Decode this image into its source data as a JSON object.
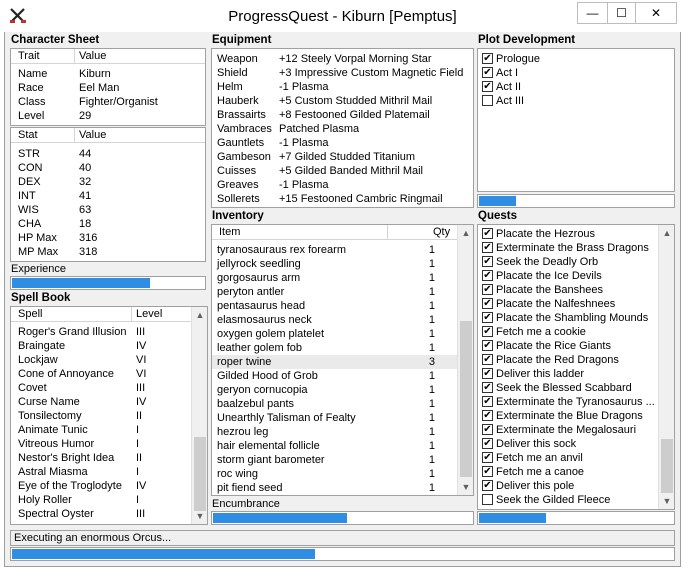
{
  "window": {
    "title": "ProgressQuest - Kiburn [Pemptus]",
    "icon": "swords-icon",
    "minimize": "—",
    "maximize": "☐",
    "close": "✕"
  },
  "character_sheet": {
    "label": "Character Sheet",
    "traits_header": [
      "Trait",
      "Value"
    ],
    "traits": [
      {
        "k": "Name",
        "v": "Kiburn"
      },
      {
        "k": "Race",
        "v": "Eel Man"
      },
      {
        "k": "Class",
        "v": "Fighter/Organist"
      },
      {
        "k": "Level",
        "v": "29"
      }
    ],
    "stats_header": [
      "Stat",
      "Value"
    ],
    "stats": [
      {
        "k": "STR",
        "v": "44"
      },
      {
        "k": "CON",
        "v": "40"
      },
      {
        "k": "DEX",
        "v": "32"
      },
      {
        "k": "INT",
        "v": "41"
      },
      {
        "k": "WIS",
        "v": "63"
      },
      {
        "k": "CHA",
        "v": "18"
      },
      {
        "k": "HP Max",
        "v": "316"
      },
      {
        "k": "MP Max",
        "v": "318"
      }
    ],
    "experience_label": "Experience",
    "experience_progress": 0.72
  },
  "spell_book": {
    "label": "Spell Book",
    "header": [
      "Spell",
      "Level"
    ],
    "spells": [
      {
        "name": "Roger's Grand Illusion",
        "level": "III"
      },
      {
        "name": "Braingate",
        "level": "IV"
      },
      {
        "name": "Lockjaw",
        "level": "VI"
      },
      {
        "name": "Cone of Annoyance",
        "level": "VI"
      },
      {
        "name": "Covet",
        "level": "III"
      },
      {
        "name": "Curse Name",
        "level": "IV"
      },
      {
        "name": "Tonsilectomy",
        "level": "II"
      },
      {
        "name": "Animate Tunic",
        "level": "I"
      },
      {
        "name": "Vitreous Humor",
        "level": "I"
      },
      {
        "name": "Nestor's Bright Idea",
        "level": "II"
      },
      {
        "name": "Astral Miasma",
        "level": "I"
      },
      {
        "name": "Eye of the Troglodyte",
        "level": "IV"
      },
      {
        "name": "Holy Roller",
        "level": "I"
      },
      {
        "name": "Spectral Oyster",
        "level": "III"
      }
    ]
  },
  "equipment": {
    "label": "Equipment",
    "items": [
      {
        "slot": "Weapon",
        "item": "+12 Steely Vorpal Morning Star"
      },
      {
        "slot": "Shield",
        "item": "+3 Impressive Custom Magnetic Field"
      },
      {
        "slot": "Helm",
        "item": "-1 Plasma"
      },
      {
        "slot": "Hauberk",
        "item": "+5 Custom Studded Mithril Mail"
      },
      {
        "slot": "Brassairts",
        "item": "+8 Festooned Gilded Platemail"
      },
      {
        "slot": "Vambraces",
        "item": "Patched Plasma"
      },
      {
        "slot": "Gauntlets",
        "item": "-1 Plasma"
      },
      {
        "slot": "Gambeson",
        "item": "+7 Gilded Studded Titanium"
      },
      {
        "slot": "Cuisses",
        "item": "+5 Gilded Banded Mithril Mail"
      },
      {
        "slot": "Greaves",
        "item": "-1 Plasma"
      },
      {
        "slot": "Sollerets",
        "item": "+15 Festooned Cambric Ringmail"
      }
    ]
  },
  "inventory": {
    "label": "Inventory",
    "header": [
      "Item",
      "Qty"
    ],
    "items": [
      {
        "name": "tyranosauraus rex forearm",
        "qty": "1"
      },
      {
        "name": "jellyrock seedling",
        "qty": "1"
      },
      {
        "name": "gorgosaurus arm",
        "qty": "1"
      },
      {
        "name": "peryton antler",
        "qty": "1"
      },
      {
        "name": "pentasaurus head",
        "qty": "1"
      },
      {
        "name": "elasmosaurus neck",
        "qty": "1"
      },
      {
        "name": "oxygen golem platelet",
        "qty": "1"
      },
      {
        "name": "leather golem fob",
        "qty": "1"
      },
      {
        "name": "roper twine",
        "qty": "3"
      },
      {
        "name": "Gilded Hood of Grob",
        "qty": "1"
      },
      {
        "name": "geryon cornucopia",
        "qty": "1"
      },
      {
        "name": "baalzebul pants",
        "qty": "1"
      },
      {
        "name": "Unearthly Talisman of Fealty",
        "qty": "1"
      },
      {
        "name": "hezrou leg",
        "qty": "1"
      },
      {
        "name": "hair elemental follicle",
        "qty": "1"
      },
      {
        "name": "storm giant barometer",
        "qty": "1"
      },
      {
        "name": "roc wing",
        "qty": "1"
      },
      {
        "name": "pit fiend seed",
        "qty": "1"
      }
    ],
    "encumbrance_label": "Encumbrance",
    "encumbrance_progress": 0.52
  },
  "plot": {
    "label": "Plot Development",
    "acts": [
      {
        "name": "Prologue",
        "checked": true
      },
      {
        "name": "Act I",
        "checked": true
      },
      {
        "name": "Act II",
        "checked": true
      },
      {
        "name": "Act III",
        "checked": false
      }
    ],
    "progress": 0.2
  },
  "quests": {
    "label": "Quests",
    "items": [
      {
        "name": "Placate the Hezrous",
        "checked": true
      },
      {
        "name": "Exterminate the Brass Dragons",
        "checked": true
      },
      {
        "name": "Seek the Deadly Orb",
        "checked": true
      },
      {
        "name": "Placate the Ice Devils",
        "checked": true
      },
      {
        "name": "Placate the Banshees",
        "checked": true
      },
      {
        "name": "Placate the Nalfeshnees",
        "checked": true
      },
      {
        "name": "Placate the Shambling Mounds",
        "checked": true
      },
      {
        "name": "Fetch me a cookie",
        "checked": true
      },
      {
        "name": "Placate the Rice Giants",
        "checked": true
      },
      {
        "name": "Placate the Red Dragons",
        "checked": true
      },
      {
        "name": "Deliver this ladder",
        "checked": true
      },
      {
        "name": "Seek the Blessed Scabbard",
        "checked": true
      },
      {
        "name": "Exterminate the Tyranosaurus ...",
        "checked": true
      },
      {
        "name": "Exterminate the Blue Dragons",
        "checked": true
      },
      {
        "name": "Exterminate the Megalosauri",
        "checked": true
      },
      {
        "name": "Deliver this sock",
        "checked": true
      },
      {
        "name": "Fetch me an anvil",
        "checked": true
      },
      {
        "name": "Fetch me a canoe",
        "checked": true
      },
      {
        "name": "Deliver this pole",
        "checked": true
      },
      {
        "name": "Seek the Gilded Fleece",
        "checked": false
      }
    ],
    "progress": 0.35
  },
  "status": {
    "text": "Executing an enormous Orcus...",
    "progress": 0.46
  },
  "colors": {
    "progress": "#2f8de4",
    "panel": "#f0f0f0"
  }
}
